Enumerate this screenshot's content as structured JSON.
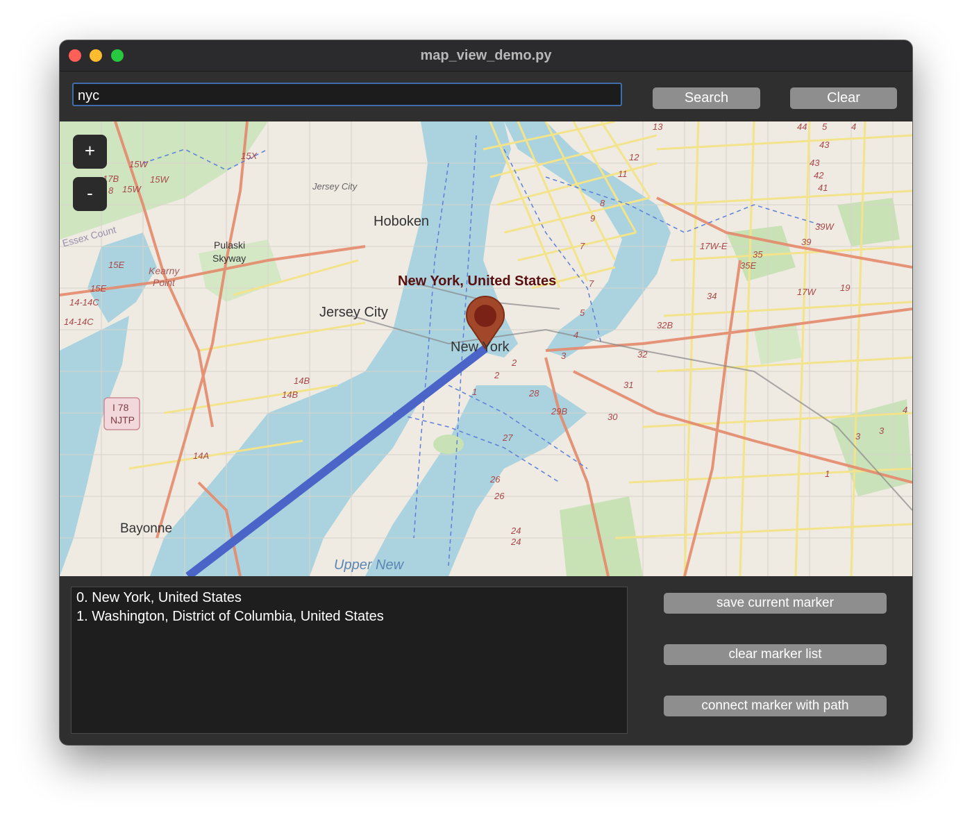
{
  "window": {
    "title": "map_view_demo.py"
  },
  "search": {
    "value": "nyc",
    "search_label": "Search",
    "clear_label": "Clear"
  },
  "map": {
    "zoom_in_label": "+",
    "zoom_out_label": "-",
    "marker_label": "New York, United States",
    "marker_color": "#9b3b20",
    "path_color": "#4a64c8",
    "place_labels": {
      "hoboken": "Hoboken",
      "jersey_city": "Jersey City",
      "new_york": "New York",
      "bayonne": "Bayonne",
      "pulaski": "Pulaski",
      "skyway": "Skyway",
      "kearny": "Kearny",
      "point": "Point",
      "essex": "Essex Count",
      "upper_new": "Upper New",
      "jersey_city_small": "Jersey City",
      "shield_line1": "I 78",
      "shield_line2": "NJTP"
    },
    "route_labels": {
      "r15w_a": "15W",
      "r15w_b": "15W",
      "r15w_c": "15W",
      "r17b": "17B",
      "r8": "8",
      "r15x": "15X",
      "r15e_a": "15E",
      "r15e_b": "15E",
      "r14c_a": "14-14C",
      "r14c_b": "14-14C",
      "r14b_a": "14B",
      "r14b_b": "14B",
      "r14a": "14A",
      "r13": "13",
      "r12": "12",
      "r11": "11",
      "r9": "9",
      "r8b": "8",
      "r7": "7",
      "r7b": "7",
      "r5": "5",
      "r4": "4",
      "r3": "3",
      "r2": "2",
      "r1": "1",
      "r28": "28",
      "r29b": "29B",
      "r30": "30",
      "r27": "27",
      "r26": "26",
      "r26b": "26",
      "r24": "24",
      "r24b": "24",
      "r31": "31",
      "r32": "32",
      "r32b": "32B",
      "r34": "34",
      "r35": "35",
      "r35e": "35E",
      "r17we": "17W-E",
      "r17w": "17W",
      "r39": "39",
      "r39w": "39W",
      "r19": "19",
      "r41": "41",
      "r42": "42",
      "r43": "43",
      "r43b": "43",
      "r44": "44",
      "r5b": "5",
      "r4b": "4",
      "r4c": "4",
      "r3b": "3",
      "r3c": "3",
      "r2b": "2",
      "r1b": "1"
    }
  },
  "markers": {
    "items": [
      "0. New York, United States",
      "1. Washington, District of Columbia, United States"
    ],
    "save_label": "save current marker",
    "clear_label": "clear marker list",
    "connect_label": "connect marker with path"
  }
}
